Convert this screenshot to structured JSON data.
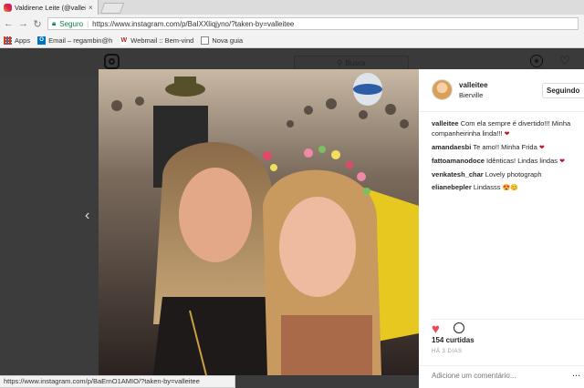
{
  "browser": {
    "tab_title": "Valdirene Leite (@vallei",
    "tab_close": "×",
    "security_label": "Seguro",
    "url_sep": "|",
    "url": "https://www.instagram.com/p/BaIXXliqjyno/?taken-by=valleitee",
    "bookmarks": [
      {
        "label": "Apps",
        "icon": "apps-icon"
      },
      {
        "label": "Email – regambin@h",
        "icon": "outlook-icon"
      },
      {
        "label": "Webmail :: Bem-vind",
        "icon": "webmail-icon"
      },
      {
        "label": "Nova guia",
        "icon": "document-icon"
      }
    ],
    "status_url": "https://www.instagram.com/p/BaErnO1AMIO/?taken-by=valleitee"
  },
  "instagram": {
    "search_placeholder": "Busca",
    "post": {
      "username": "valleitee",
      "location": "Bierville",
      "follow_label": "Seguindo",
      "comments": [
        {
          "user": "valleitee",
          "text": "Com ela sempre é divertido!!! Minha companheirinha linda!!!",
          "emoji": "❤"
        },
        {
          "user": "amandaesbi",
          "text": "Te amo!! Minha Frida",
          "emoji": "❤"
        },
        {
          "user": "fattoamanodoce",
          "text": "Idênticas! Lindas lindas",
          "emoji": "❤"
        },
        {
          "user": "venkatesh_char",
          "text": "Lovely photograph",
          "emoji": ""
        },
        {
          "user": "elianebepler",
          "text": "Lindasss",
          "emoji": "😍😊"
        }
      ],
      "likes": "154 curtidas",
      "time_ago": "HÁ 3 DIAS",
      "add_comment_placeholder": "Adicione um comentário...",
      "more_label": "..."
    }
  },
  "colors": {
    "like_heart": "#ed4956",
    "secure_green": "#0b8043",
    "overlay": "#3c3c3c"
  }
}
